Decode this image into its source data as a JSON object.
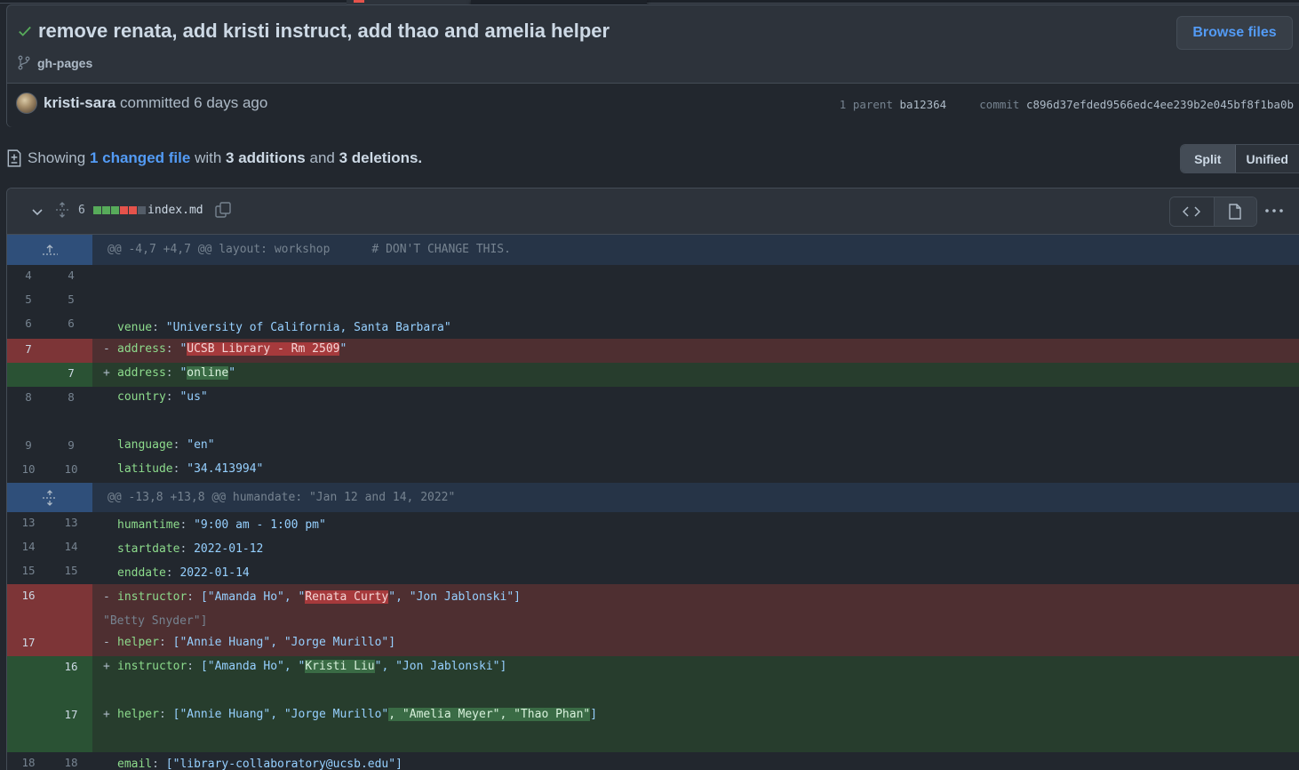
{
  "commit": {
    "title": "remove renata, add kristi instruct, add thao and amelia helper",
    "branch": "gh-pages",
    "browse_label": "Browse files",
    "author": "kristi-sara",
    "committed_text": "committed 6 days ago",
    "parent_label": "1 parent",
    "parent_sha": "ba12364",
    "commit_label": "commit",
    "commit_sha": "c896d37efded9566edc4ee239b2e045bf8f1ba0b"
  },
  "summary": {
    "showing": "Showing",
    "changed_files": "1 changed file",
    "with": "with",
    "additions": "3 additions",
    "and": "and",
    "deletions": "3 deletions."
  },
  "view_toggle": {
    "split": "Split",
    "unified": "Unified"
  },
  "file": {
    "change_count": "6",
    "name": "index.md",
    "bar_colors": [
      "#57ab5a",
      "#57ab5a",
      "#57ab5a",
      "#e5534b",
      "#e5534b",
      "#545d68"
    ]
  },
  "hunks": [
    {
      "header": "@@ -4,7 +4,7 @@ layout: workshop      # DON'T CHANGE THIS."
    },
    {
      "header": "@@ -13,8 +13,8 @@ humandate: \"Jan 12 and 14, 2022\""
    }
  ],
  "lines": {
    "l4": {
      "old": "4",
      "new": "4"
    },
    "l5": {
      "old": "5",
      "new": "5"
    },
    "l6": {
      "old": "6",
      "new": "6",
      "key": "venue",
      "value": "\"University of California, Santa Barbara\""
    },
    "d7": {
      "old": "7",
      "key": "address",
      "pre": "\"",
      "hl": "UCSB Library - Rm 2509",
      "post": "\""
    },
    "a7": {
      "new": "7",
      "key": "address",
      "pre": "\"",
      "hl": "online",
      "post": "\""
    },
    "l8": {
      "old": "8",
      "new": "8",
      "key": "country",
      "value": "\"us\""
    },
    "l9": {
      "old": "9",
      "new": "9",
      "key": "language",
      "value": "\"en\""
    },
    "l10": {
      "old": "10",
      "new": "10",
      "key": "latitude",
      "value": "\"34.413994\""
    },
    "l13": {
      "old": "13",
      "new": "13",
      "key": "humantime",
      "value": "\"9:00 am - 1:00 pm\""
    },
    "l14": {
      "old": "14",
      "new": "14",
      "key": "startdate",
      "value": "2022-01-12"
    },
    "l15": {
      "old": "15",
      "new": "15",
      "key": "enddate",
      "value": "2022-01-14"
    },
    "d16": {
      "old": "16",
      "key": "instructor",
      "pre": "[\"Amanda Ho\", \"",
      "hl": "Renata Curty",
      "post": "\", \"Jon Jablonski\"]"
    },
    "d16_wrap": "\"Betty Snyder\"]",
    "d17": {
      "old": "17",
      "key": "helper",
      "value": "[\"Annie Huang\", \"Jorge Murillo\"]"
    },
    "a16": {
      "new": "16",
      "key": "instructor",
      "pre": "[\"Amanda Ho\", \"",
      "hl": "Kristi Liu",
      "post": "\", \"Jon Jablonski\"]"
    },
    "a17": {
      "new": "17",
      "key": "helper",
      "pre": "[\"Annie Huang\", \"Jorge Murillo\"",
      "hl": ", \"Amelia Meyer\", \"Thao Phan\"",
      "post": "]"
    },
    "l18": {
      "old": "18",
      "new": "18",
      "key": "email",
      "value": "[\"library-collaboratory@ucsb.edu\"]"
    }
  },
  "signs": {
    "del": "-",
    "add": "+",
    "colon": ": "
  }
}
